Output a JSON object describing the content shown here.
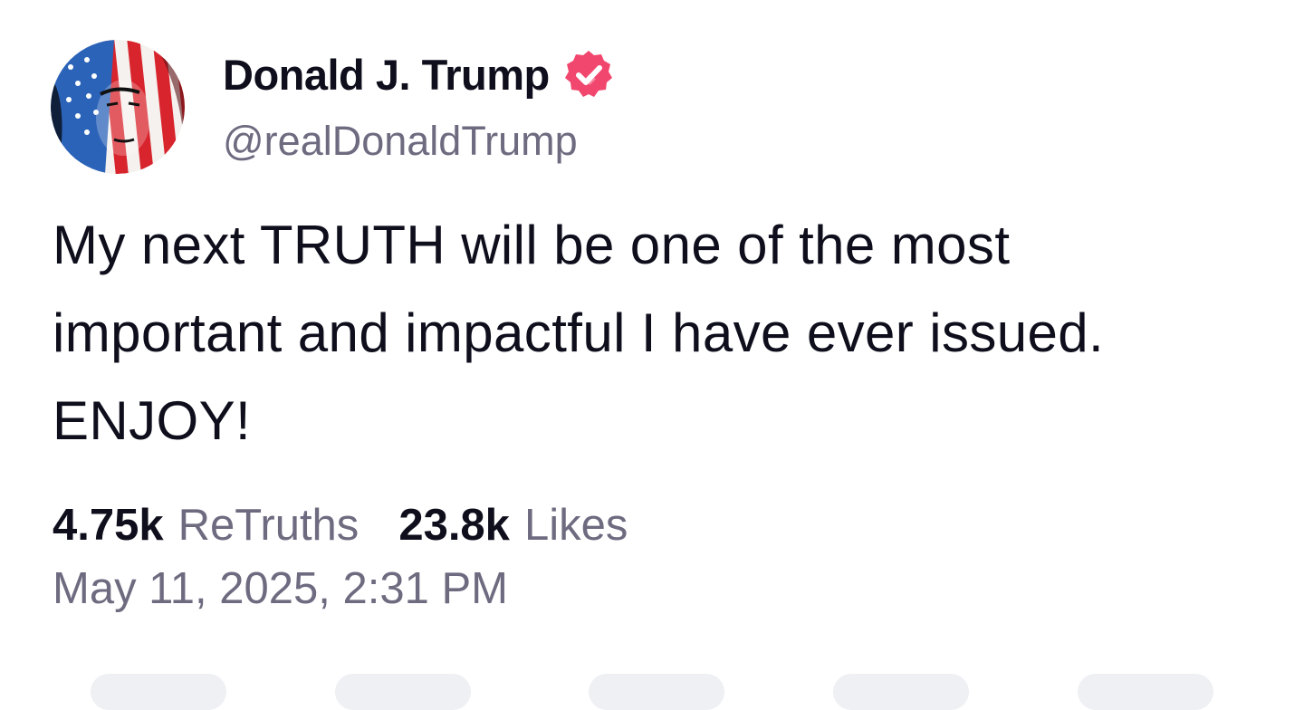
{
  "author": {
    "name": "Donald J. Trump",
    "handle": "@realDonaldTrump",
    "verified": true,
    "badge_color": "#f1466e",
    "avatar_icon": "flag-portrait-avatar"
  },
  "post": {
    "lines": [
      "My next TRUTH will be one of the most",
      "important and impactful I have ever issued.",
      "ENJOY!"
    ]
  },
  "stats": {
    "retruths_count": "4.75k",
    "retruths_label": "ReTruths",
    "likes_count": "23.8k",
    "likes_label": "Likes"
  },
  "timestamp": "May 11, 2025, 2:31 PM",
  "colors": {
    "text_primary": "#0e0e1c",
    "text_secondary": "#6e6b80",
    "background": "#ffffff"
  }
}
